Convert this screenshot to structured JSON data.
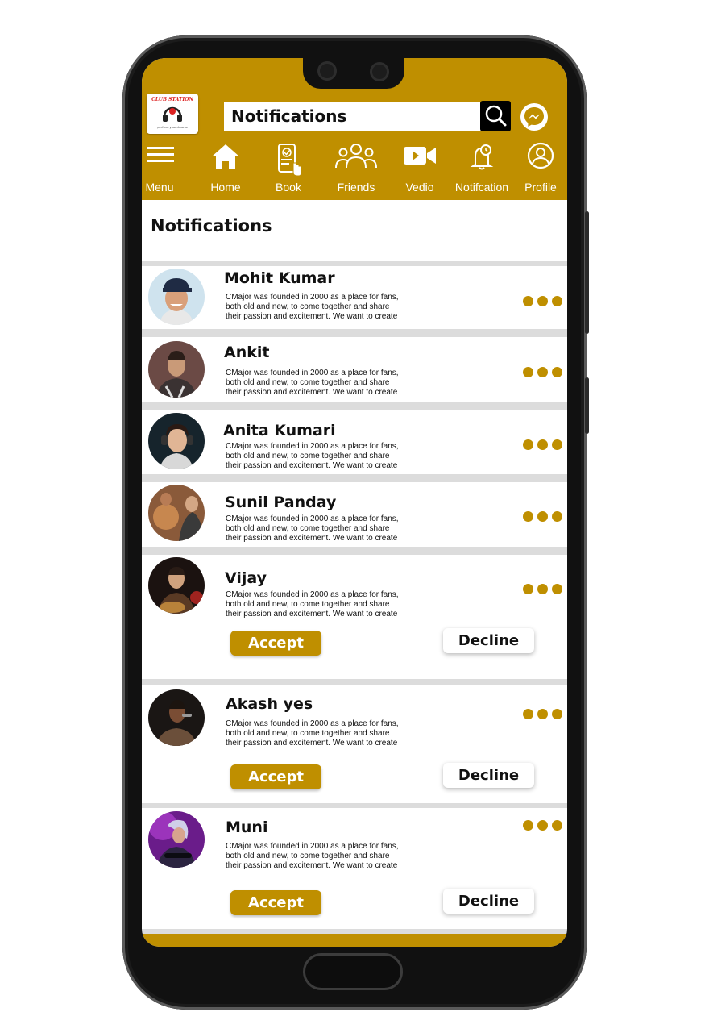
{
  "app": {
    "logo_text": "CLUB STATION",
    "logo_tagline": "perform your dreams",
    "search_value": "Notifications",
    "search_icon": "search-icon",
    "messenger_icon": "messenger-icon"
  },
  "nav": [
    {
      "label": "Menu",
      "icon": "menu-icon"
    },
    {
      "label": "Home",
      "icon": "home-icon"
    },
    {
      "label": "Book",
      "icon": "book-icon"
    },
    {
      "label": "Friends",
      "icon": "friends-icon"
    },
    {
      "label": "Vedio",
      "icon": "video-icon"
    },
    {
      "label": "Notifcation",
      "icon": "notification-icon"
    },
    {
      "label": "Profile",
      "icon": "profile-icon"
    }
  ],
  "page": {
    "title": "Notifications"
  },
  "notifications": [
    {
      "name": "Mohit Kumar",
      "line1": "CMajor was founded in 2000 as a place for fans,",
      "line2": "both old and new, to come together and share",
      "line3": "their passion and excitement. We want to create"
    },
    {
      "name": "Ankit",
      "line1": "CMajor was founded in 2000 as a place for fans,",
      "line2": "both old and new, to come together and share",
      "line3": "their passion and excitement. We want to create"
    },
    {
      "name": "Anita Kumari",
      "line1": "CMajor was founded in 2000 as a place for fans,",
      "line2": "both old and new, to come together and share",
      "line3": "their passion and excitement. We want to create"
    },
    {
      "name": "Sunil Panday",
      "line1": "CMajor was founded in 2000 as a place for fans,",
      "line2": "both old and new, to come together and share",
      "line3": "their passion and excitement. We want to create"
    },
    {
      "name": "Vijay",
      "line1": "CMajor was founded in 2000 as a place for fans,",
      "line2": "both old and new, to come together and share",
      "line3": "their passion and excitement. We want to create",
      "accept": "Accept",
      "decline": "Decline"
    },
    {
      "name": "Akash yes",
      "line1": "CMajor was founded in 2000 as a place for fans,",
      "line2": "both old and new, to come together and share",
      "line3": "their passion and excitement. We want to create",
      "accept": "Accept",
      "decline": "Decline"
    },
    {
      "name": "Muni",
      "line1": "CMajor was founded in 2000 as a place for fans,",
      "line2": "both old and new, to come together and share",
      "line3": "their passion and excitement. We want to create",
      "accept": "Accept",
      "decline": "Decline"
    }
  ],
  "colors": {
    "accent": "#bf8f00",
    "background": "#ffffff",
    "divider": "#dcdcdc"
  }
}
